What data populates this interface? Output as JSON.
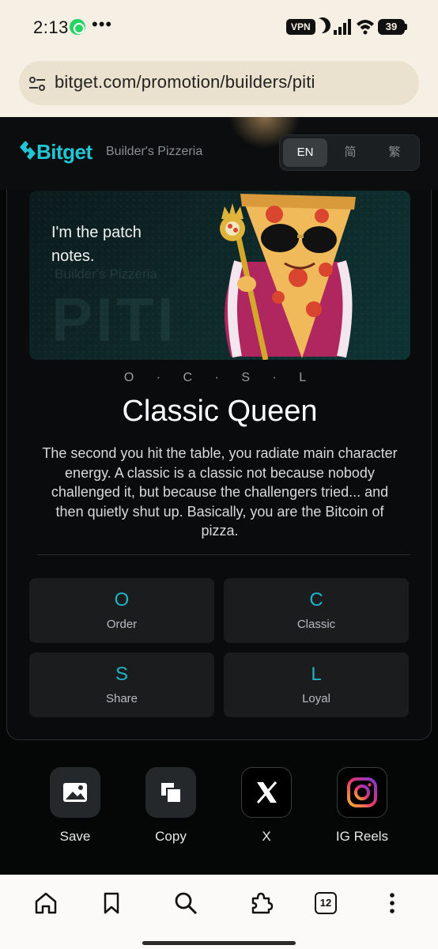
{
  "status_bar": {
    "time": "2:13",
    "vpn": "VPN",
    "battery": "39"
  },
  "browser": {
    "url": "bitget.com/promotion/builders/piti"
  },
  "header": {
    "brand": "Bitget",
    "subtitle": "Builder's Pizzeria",
    "languages": [
      "EN",
      "简",
      "繁"
    ],
    "active_language": "EN"
  },
  "banner": {
    "quote": "I'm the patch notes.",
    "watermark_small": "Builder's Pizzeria",
    "watermark_big": "PITI"
  },
  "result": {
    "letters": "O · C · S · L",
    "title": "Classic Queen",
    "description": "The second you hit the table, you radiate main character energy. A classic is a classic not because nobody challenged it, but because the challengers tried... and then quietly shut up. Basically, you are the Bitcoin of pizza."
  },
  "traits": [
    {
      "letter": "O",
      "label": "Order"
    },
    {
      "letter": "C",
      "label": "Classic"
    },
    {
      "letter": "S",
      "label": "Share"
    },
    {
      "letter": "L",
      "label": "Loyal"
    }
  ],
  "share": [
    {
      "label": "Save",
      "icon": "image-icon"
    },
    {
      "label": "Copy",
      "icon": "copy-icon"
    },
    {
      "label": "X",
      "icon": "x-logo-icon"
    },
    {
      "label": "IG Reels",
      "icon": "instagram-icon"
    }
  ],
  "bottom_nav": {
    "tab_count": "12"
  },
  "colors": {
    "accent": "#1fc7d4",
    "trait_letter": "#1fb3c6",
    "card_bg": "#1a1c1e"
  }
}
